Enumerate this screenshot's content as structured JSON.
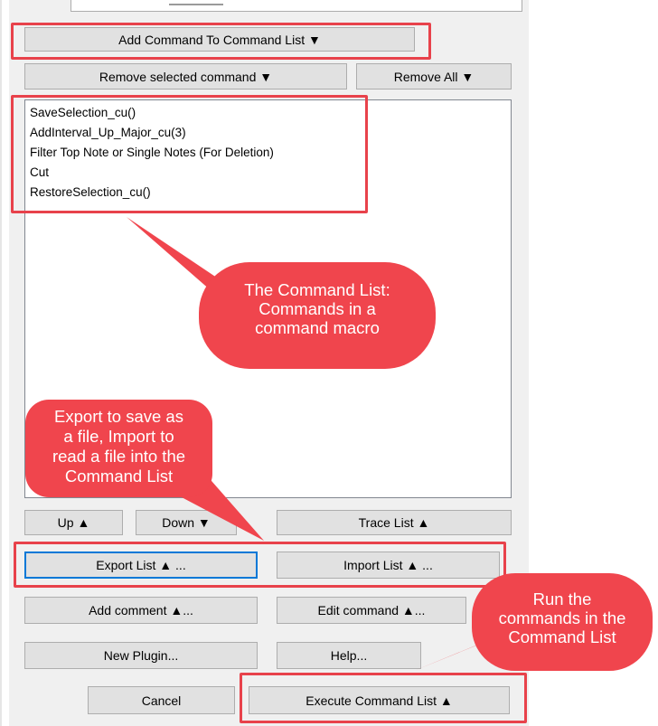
{
  "buttons": {
    "add_command": "Add Command To Command List ▼",
    "remove_selected": "Remove selected command ▼",
    "remove_all": "Remove All ▼",
    "up": "Up ▲",
    "down": "Down ▼",
    "trace_list": "Trace List ▲",
    "export_list": "Export List ▲ ...",
    "import_list": "Import List ▲ ...",
    "add_comment": "Add comment ▲...",
    "edit_command": "Edit command ▲...",
    "new_plugin": "New Plugin...",
    "help": "Help...",
    "cancel": "Cancel",
    "execute": "Execute Command List ▲"
  },
  "command_list": [
    "SaveSelection_cu()",
    "AddInterval_Up_Major_cu(3)",
    "Filter Top Note or Single Notes (For Deletion)",
    "Cut",
    "RestoreSelection_cu()"
  ],
  "callouts": {
    "command_list": [
      "The Command List:",
      "Commands in a",
      "command macro"
    ],
    "export_import": [
      "Export to save as",
      "a file, Import to",
      "read a file into the",
      "Command List"
    ],
    "run": [
      "Run the",
      "commands in the",
      "Command List"
    ]
  },
  "colors": {
    "annotation": "#e8424b",
    "callout_fill": "#f0454d",
    "focus": "#0078d7"
  }
}
